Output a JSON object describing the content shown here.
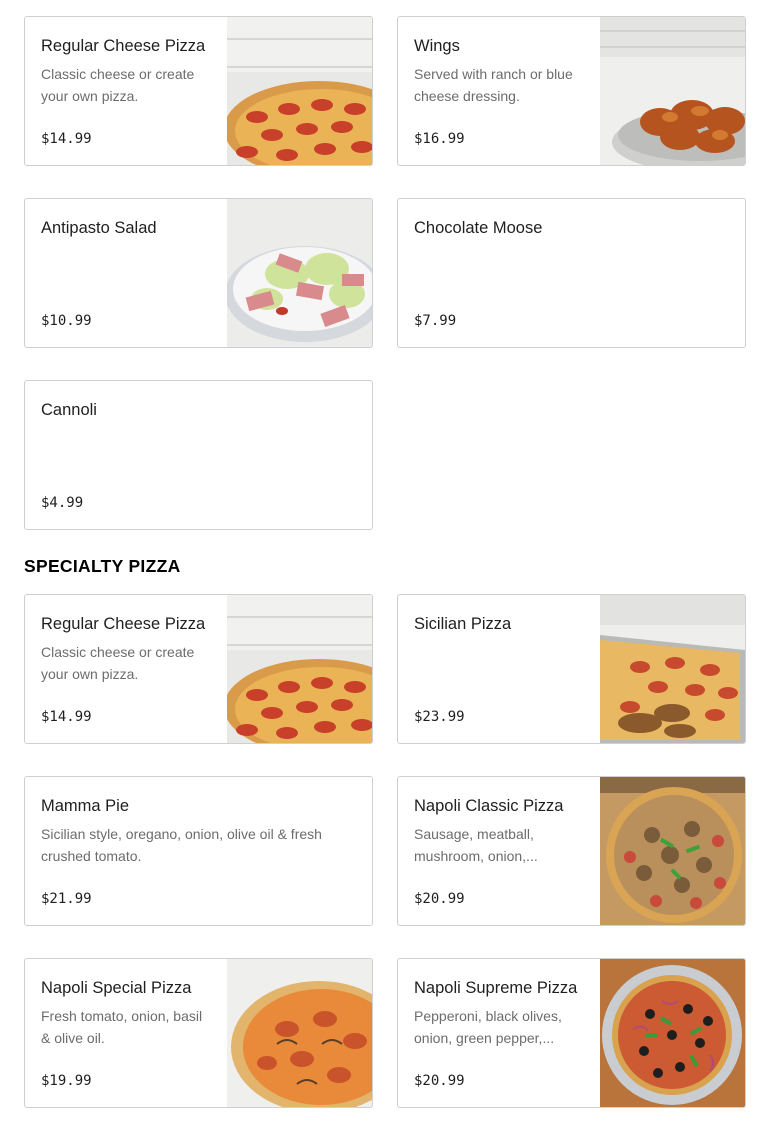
{
  "popular": [
    {
      "name": "Regular Cheese Pizza",
      "desc": "Classic cheese or create your own pizza.",
      "price": "$14.99",
      "image": "cheese-pizza-photo"
    },
    {
      "name": "Wings",
      "desc": "Served with ranch or blue cheese dressing.",
      "price": "$16.99",
      "image": "wings-photo"
    },
    {
      "name": "Antipasto Salad",
      "desc": "",
      "price": "$10.99",
      "image": "salad-photo"
    },
    {
      "name": "Chocolate Moose",
      "desc": "",
      "price": "$7.99",
      "image": ""
    },
    {
      "name": "Cannoli",
      "desc": "",
      "price": "$4.99",
      "image": ""
    }
  ],
  "specialty": {
    "title": "SPECIALTY PIZZA",
    "items": [
      {
        "name": "Regular Cheese Pizza",
        "desc": "Classic cheese or create your own pizza.",
        "price": "$14.99",
        "image": "cheese-pizza-photo"
      },
      {
        "name": "Sicilian Pizza",
        "desc": "",
        "price": "$23.99",
        "image": "sicilian-pizza-photo"
      },
      {
        "name": "Mamma Pie",
        "desc": "Sicilian style, oregano, onion, olive oil & fresh crushed tomato.",
        "price": "$21.99",
        "image": ""
      },
      {
        "name": "Napoli Classic Pizza",
        "desc": "Sausage, meatball, mushroom, onion,...",
        "price": "$20.99",
        "image": "classic-pizza-photo"
      },
      {
        "name": "Napoli Special Pizza",
        "desc": "Fresh tomato, onion, basil & olive oil.",
        "price": "$19.99",
        "image": "special-pizza-photo"
      },
      {
        "name": "Napoli Supreme Pizza",
        "desc": "Pepperoni, black olives, onion, green pepper,...",
        "price": "$20.99",
        "image": "supreme-pizza-photo"
      }
    ]
  }
}
